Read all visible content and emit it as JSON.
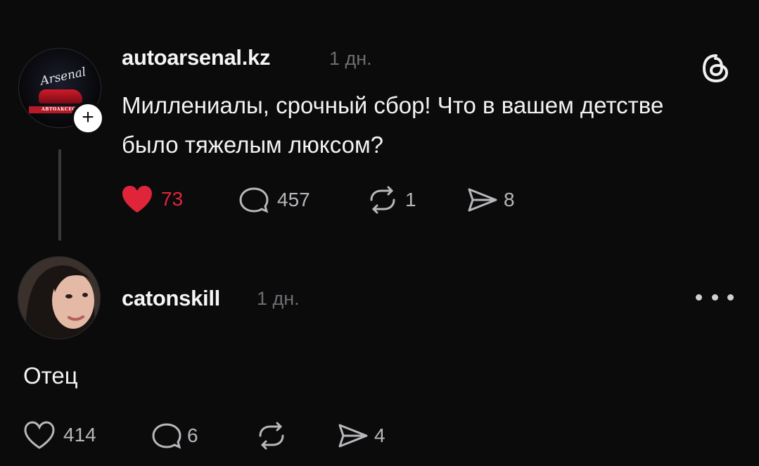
{
  "post": {
    "avatar_logo_text": "Arsenal",
    "avatar_band_text": "АВТОАКСЕСС",
    "username": "autoarsenal.kz",
    "time": "1 дн.",
    "text": "Миллениалы, срочный сбор! Что в вашем детстве было тяжелым люксом?",
    "likes": "73",
    "comments": "457",
    "reposts": "1",
    "shares": "8",
    "like_color": "#e0253a"
  },
  "reply": {
    "username": "catonskill",
    "time": "1 дн.",
    "text": "Отец",
    "likes": "414",
    "comments": "6",
    "shares": "4"
  },
  "icons": {
    "app": "threads-icon",
    "add": "plus-icon",
    "more": "more-icon"
  }
}
